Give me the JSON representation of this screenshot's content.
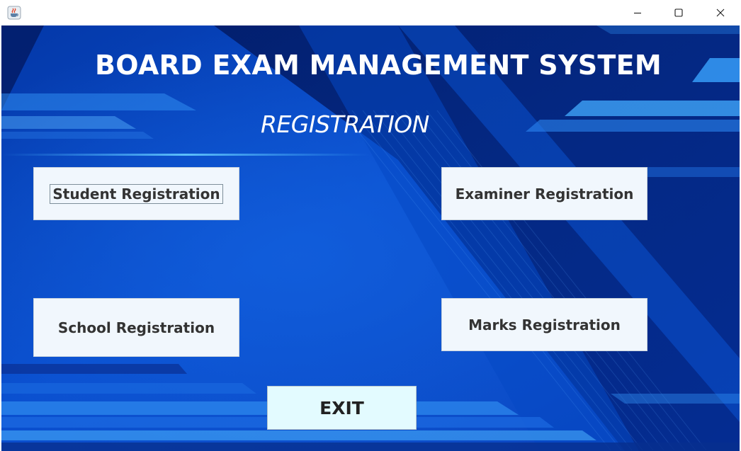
{
  "window": {
    "app_icon": "java-cup-icon",
    "controls": {
      "minimize_icon": "minimize-icon",
      "maximize_icon": "maximize-icon",
      "close_icon": "close-icon"
    }
  },
  "header": {
    "title": "BOARD EXAM MANAGEMENT SYSTEM",
    "subtitle": "REGISTRATION"
  },
  "buttons": {
    "student": "Student Registration",
    "examiner": "Examiner Registration",
    "school": "School Registration",
    "marks": "Marks Registration",
    "exit": "EXIT"
  },
  "focused_button": "student",
  "colors": {
    "background_dark": "#02227a",
    "background_mid": "#0a4ed0",
    "accent_light": "#2f9bff",
    "button_bg": "#f1f7fd",
    "exit_button_bg": "#e3fbff",
    "title_text": "#ffffff",
    "button_text": "#333333"
  }
}
